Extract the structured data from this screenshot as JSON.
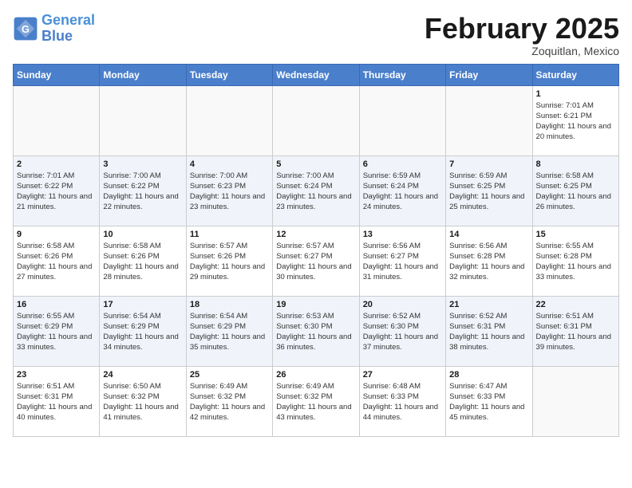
{
  "header": {
    "logo_general": "General",
    "logo_blue": "Blue",
    "main_title": "February 2025",
    "subtitle": "Zoquitlan, Mexico"
  },
  "days_of_week": [
    "Sunday",
    "Monday",
    "Tuesday",
    "Wednesday",
    "Thursday",
    "Friday",
    "Saturday"
  ],
  "weeks": [
    {
      "alt": false,
      "days": [
        {
          "empty": true
        },
        {
          "empty": true
        },
        {
          "empty": true
        },
        {
          "empty": true
        },
        {
          "empty": true
        },
        {
          "empty": true
        },
        {
          "num": "1",
          "sunrise": "Sunrise: 7:01 AM",
          "sunset": "Sunset: 6:21 PM",
          "daylight": "Daylight: 11 hours and 20 minutes."
        }
      ]
    },
    {
      "alt": true,
      "days": [
        {
          "num": "2",
          "sunrise": "Sunrise: 7:01 AM",
          "sunset": "Sunset: 6:22 PM",
          "daylight": "Daylight: 11 hours and 21 minutes."
        },
        {
          "num": "3",
          "sunrise": "Sunrise: 7:00 AM",
          "sunset": "Sunset: 6:22 PM",
          "daylight": "Daylight: 11 hours and 22 minutes."
        },
        {
          "num": "4",
          "sunrise": "Sunrise: 7:00 AM",
          "sunset": "Sunset: 6:23 PM",
          "daylight": "Daylight: 11 hours and 23 minutes."
        },
        {
          "num": "5",
          "sunrise": "Sunrise: 7:00 AM",
          "sunset": "Sunset: 6:24 PM",
          "daylight": "Daylight: 11 hours and 23 minutes."
        },
        {
          "num": "6",
          "sunrise": "Sunrise: 6:59 AM",
          "sunset": "Sunset: 6:24 PM",
          "daylight": "Daylight: 11 hours and 24 minutes."
        },
        {
          "num": "7",
          "sunrise": "Sunrise: 6:59 AM",
          "sunset": "Sunset: 6:25 PM",
          "daylight": "Daylight: 11 hours and 25 minutes."
        },
        {
          "num": "8",
          "sunrise": "Sunrise: 6:58 AM",
          "sunset": "Sunset: 6:25 PM",
          "daylight": "Daylight: 11 hours and 26 minutes."
        }
      ]
    },
    {
      "alt": false,
      "days": [
        {
          "num": "9",
          "sunrise": "Sunrise: 6:58 AM",
          "sunset": "Sunset: 6:26 PM",
          "daylight": "Daylight: 11 hours and 27 minutes."
        },
        {
          "num": "10",
          "sunrise": "Sunrise: 6:58 AM",
          "sunset": "Sunset: 6:26 PM",
          "daylight": "Daylight: 11 hours and 28 minutes."
        },
        {
          "num": "11",
          "sunrise": "Sunrise: 6:57 AM",
          "sunset": "Sunset: 6:26 PM",
          "daylight": "Daylight: 11 hours and 29 minutes."
        },
        {
          "num": "12",
          "sunrise": "Sunrise: 6:57 AM",
          "sunset": "Sunset: 6:27 PM",
          "daylight": "Daylight: 11 hours and 30 minutes."
        },
        {
          "num": "13",
          "sunrise": "Sunrise: 6:56 AM",
          "sunset": "Sunset: 6:27 PM",
          "daylight": "Daylight: 11 hours and 31 minutes."
        },
        {
          "num": "14",
          "sunrise": "Sunrise: 6:56 AM",
          "sunset": "Sunset: 6:28 PM",
          "daylight": "Daylight: 11 hours and 32 minutes."
        },
        {
          "num": "15",
          "sunrise": "Sunrise: 6:55 AM",
          "sunset": "Sunset: 6:28 PM",
          "daylight": "Daylight: 11 hours and 33 minutes."
        }
      ]
    },
    {
      "alt": true,
      "days": [
        {
          "num": "16",
          "sunrise": "Sunrise: 6:55 AM",
          "sunset": "Sunset: 6:29 PM",
          "daylight": "Daylight: 11 hours and 33 minutes."
        },
        {
          "num": "17",
          "sunrise": "Sunrise: 6:54 AM",
          "sunset": "Sunset: 6:29 PM",
          "daylight": "Daylight: 11 hours and 34 minutes."
        },
        {
          "num": "18",
          "sunrise": "Sunrise: 6:54 AM",
          "sunset": "Sunset: 6:29 PM",
          "daylight": "Daylight: 11 hours and 35 minutes."
        },
        {
          "num": "19",
          "sunrise": "Sunrise: 6:53 AM",
          "sunset": "Sunset: 6:30 PM",
          "daylight": "Daylight: 11 hours and 36 minutes."
        },
        {
          "num": "20",
          "sunrise": "Sunrise: 6:52 AM",
          "sunset": "Sunset: 6:30 PM",
          "daylight": "Daylight: 11 hours and 37 minutes."
        },
        {
          "num": "21",
          "sunrise": "Sunrise: 6:52 AM",
          "sunset": "Sunset: 6:31 PM",
          "daylight": "Daylight: 11 hours and 38 minutes."
        },
        {
          "num": "22",
          "sunrise": "Sunrise: 6:51 AM",
          "sunset": "Sunset: 6:31 PM",
          "daylight": "Daylight: 11 hours and 39 minutes."
        }
      ]
    },
    {
      "alt": false,
      "days": [
        {
          "num": "23",
          "sunrise": "Sunrise: 6:51 AM",
          "sunset": "Sunset: 6:31 PM",
          "daylight": "Daylight: 11 hours and 40 minutes."
        },
        {
          "num": "24",
          "sunrise": "Sunrise: 6:50 AM",
          "sunset": "Sunset: 6:32 PM",
          "daylight": "Daylight: 11 hours and 41 minutes."
        },
        {
          "num": "25",
          "sunrise": "Sunrise: 6:49 AM",
          "sunset": "Sunset: 6:32 PM",
          "daylight": "Daylight: 11 hours and 42 minutes."
        },
        {
          "num": "26",
          "sunrise": "Sunrise: 6:49 AM",
          "sunset": "Sunset: 6:32 PM",
          "daylight": "Daylight: 11 hours and 43 minutes."
        },
        {
          "num": "27",
          "sunrise": "Sunrise: 6:48 AM",
          "sunset": "Sunset: 6:33 PM",
          "daylight": "Daylight: 11 hours and 44 minutes."
        },
        {
          "num": "28",
          "sunrise": "Sunrise: 6:47 AM",
          "sunset": "Sunset: 6:33 PM",
          "daylight": "Daylight: 11 hours and 45 minutes."
        },
        {
          "empty": true
        }
      ]
    }
  ]
}
